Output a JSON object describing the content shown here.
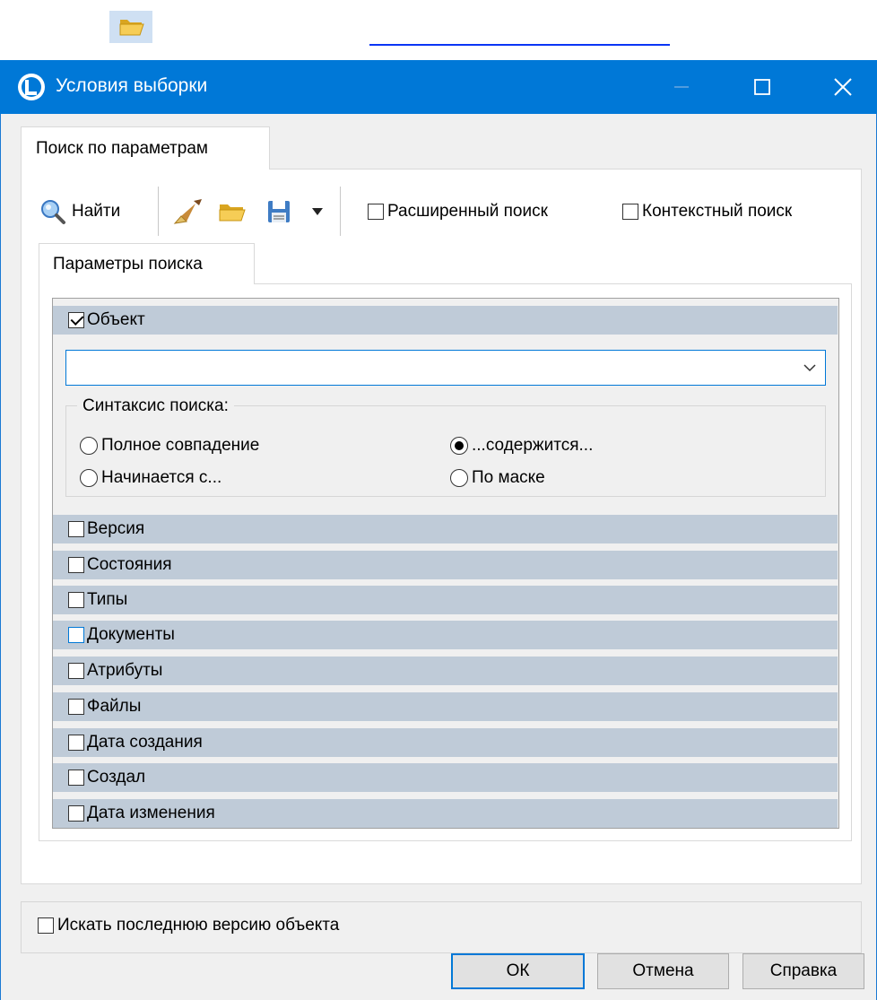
{
  "window": {
    "title": "Условия выборки",
    "icons": {
      "app": "app-logo-icon",
      "minimize": "minimize-icon",
      "maximize": "maximize-icon",
      "close": "close-icon"
    }
  },
  "top_bar": {
    "icon": "folder-open-icon"
  },
  "outer_tab": {
    "label": "Поиск по параметрам"
  },
  "toolbar": {
    "find_label": "Найти",
    "find_icon": "magnifier-icon",
    "clear_icon": "broom-icon",
    "open_icon": "folder-open-icon",
    "save_icon": "save-disk-icon",
    "dropdown_icon": "dropdown-arrow-icon",
    "extended_search": {
      "label": "Расширенный поиск",
      "checked": false
    },
    "context_search": {
      "label": "Контекстный поиск",
      "checked": false
    }
  },
  "inner_tab": {
    "label": "Параметры поиска"
  },
  "object_group": {
    "label": "Объект",
    "checked": true,
    "combo_value": "",
    "syntax": {
      "legend": "Синтаксис поиска:",
      "options": [
        {
          "label": "Полное совпадение",
          "selected": false
        },
        {
          "label": "...содержится...",
          "selected": true
        },
        {
          "label": "Начинается с...",
          "selected": false
        },
        {
          "label": "По маске",
          "selected": false
        }
      ]
    }
  },
  "groups": [
    {
      "label": "Версия",
      "checked": false
    },
    {
      "label": "Состояния",
      "checked": false
    },
    {
      "label": "Типы",
      "checked": false
    },
    {
      "label": "Документы",
      "checked": false
    },
    {
      "label": "Атрибуты",
      "checked": false
    },
    {
      "label": "Файлы",
      "checked": false
    },
    {
      "label": "Дата создания",
      "checked": false
    },
    {
      "label": "Создал",
      "checked": false
    },
    {
      "label": "Дата изменения",
      "checked": false
    }
  ],
  "last_version": {
    "label": "Искать последнюю версию объекта",
    "checked": false
  },
  "buttons": {
    "ok": "ОК",
    "cancel": "Отмена",
    "help": "Справка"
  },
  "colors": {
    "title_bar": "#0078d7",
    "group_header": "#bfcbd8",
    "underline": "#0a35f5"
  }
}
